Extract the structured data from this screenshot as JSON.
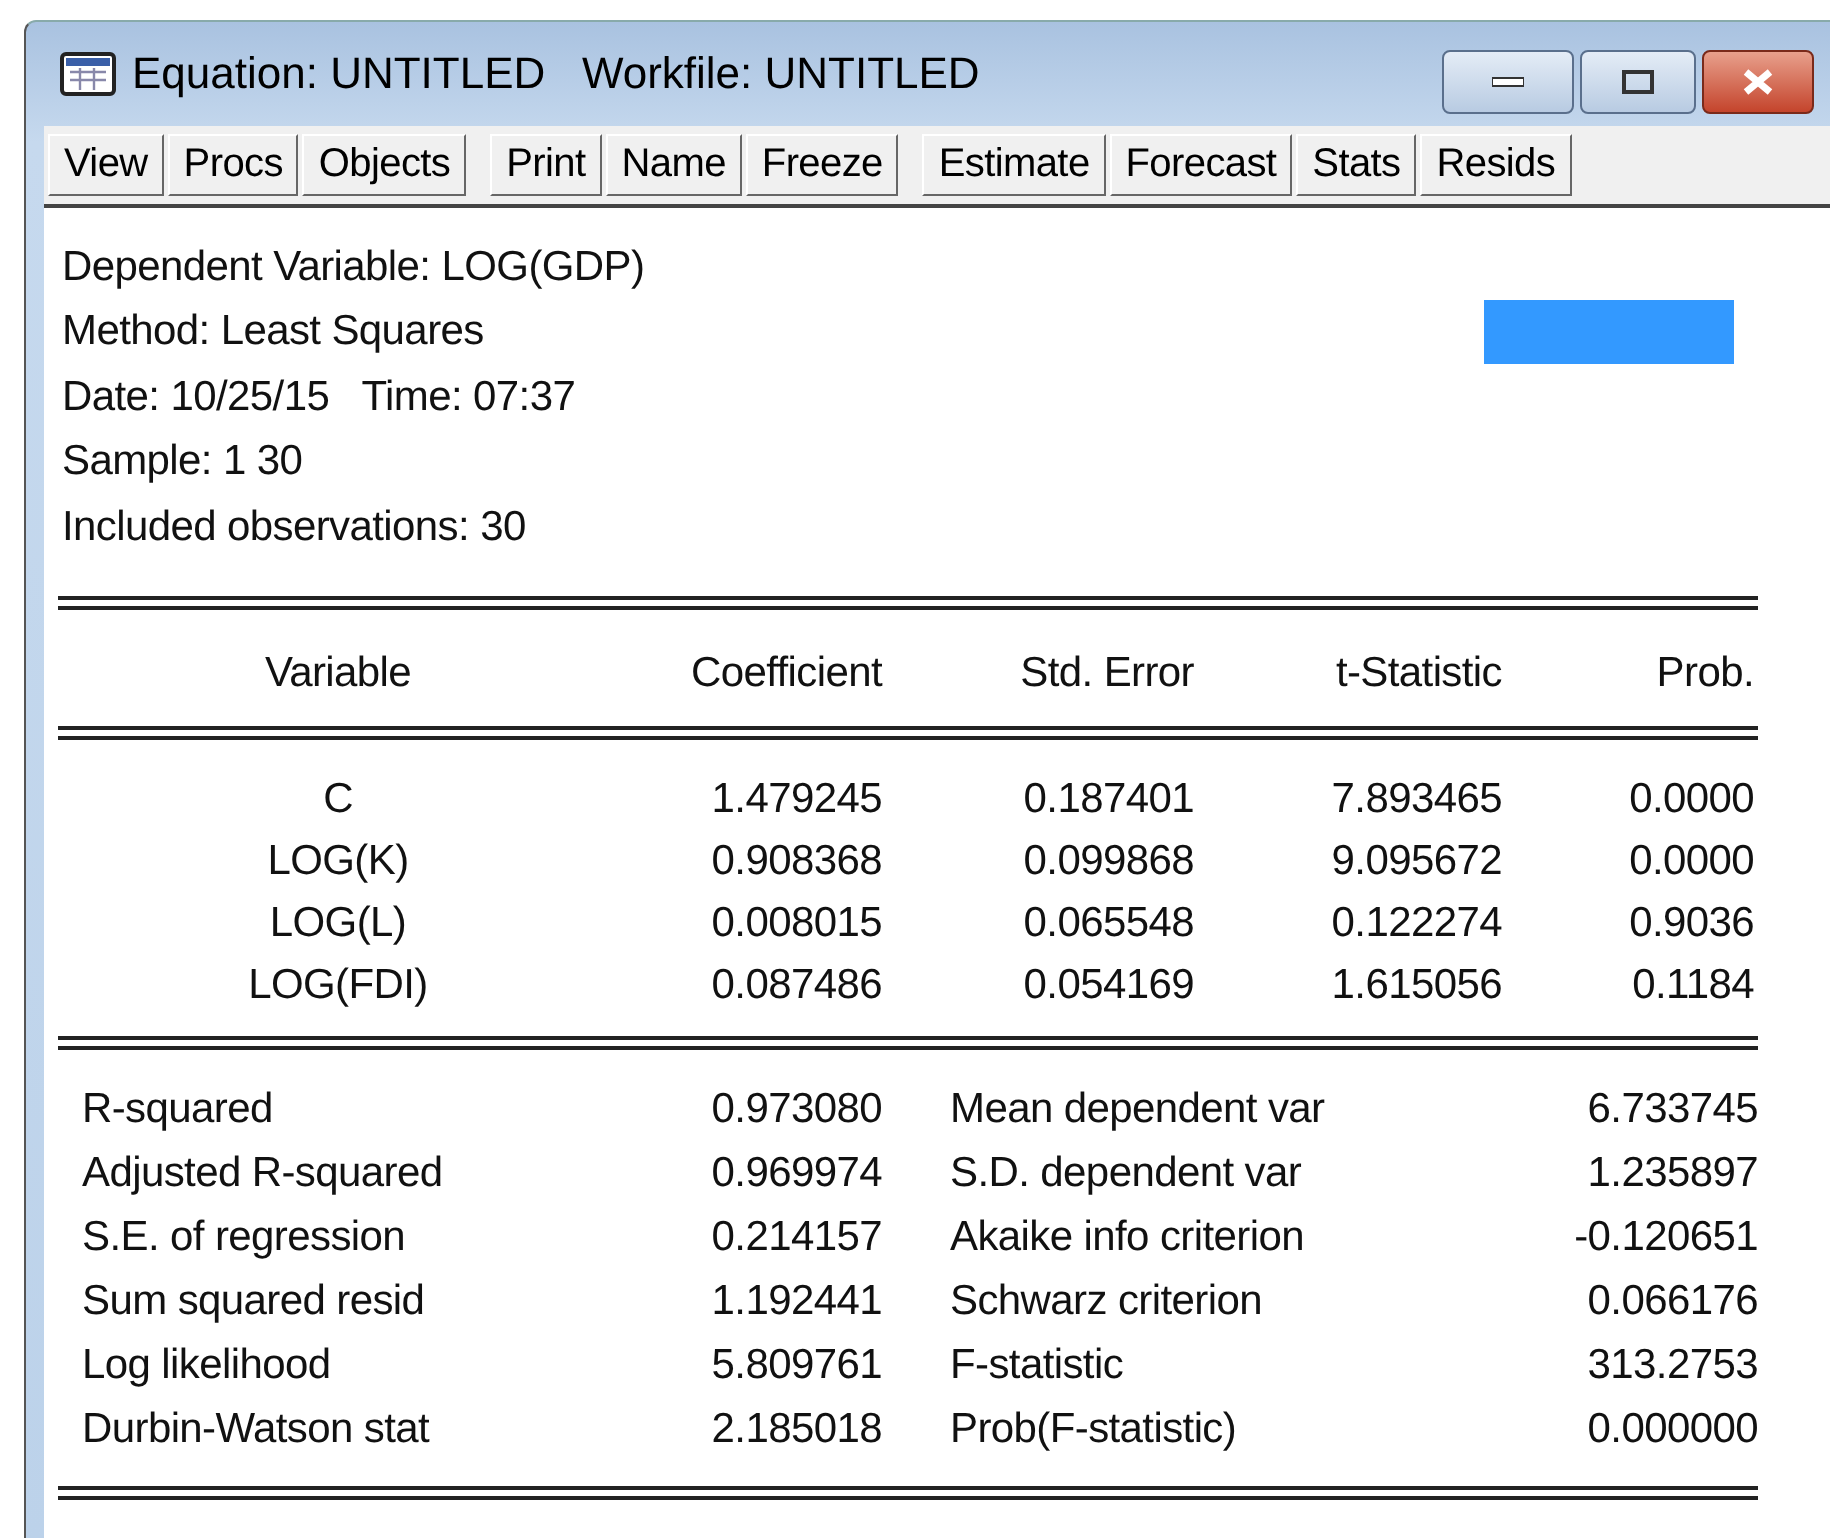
{
  "window": {
    "title": "Equation: UNTITLED   Workfile: UNTITLED"
  },
  "toolbar": [
    [
      "View",
      "Procs",
      "Objects"
    ],
    [
      "Print",
      "Name",
      "Freeze"
    ],
    [
      "Estimate",
      "Forecast",
      "Stats",
      "Resids"
    ]
  ],
  "header": [
    "Dependent Variable: LOG(GDP)",
    "Method: Least Squares",
    "Date: 10/25/15   Time: 07:37",
    "Sample: 1 30",
    "Included observations: 30"
  ],
  "table": {
    "columns": [
      "Variable",
      "Coefficient",
      "Std. Error",
      "t-Statistic",
      "Prob."
    ],
    "rows": [
      [
        "C",
        "1.479245",
        "0.187401",
        "7.893465",
        "0.0000"
      ],
      [
        "LOG(K)",
        "0.908368",
        "0.099868",
        "9.095672",
        "0.0000"
      ],
      [
        "LOG(L)",
        "0.008015",
        "0.065548",
        "0.122274",
        "0.9036"
      ],
      [
        "LOG(FDI)",
        "0.087486",
        "0.054169",
        "1.615056",
        "0.1184"
      ]
    ]
  },
  "statistics": [
    [
      "R-squared",
      "0.973080",
      "Mean dependent var",
      "6.733745"
    ],
    [
      "Adjusted R-squared",
      "0.969974",
      "S.D. dependent var",
      "1.235897"
    ],
    [
      "S.E. of regression",
      "0.214157",
      "Akaike info criterion",
      "-0.120651"
    ],
    [
      "Sum squared resid",
      "1.192441",
      "Schwarz criterion",
      "0.066176"
    ],
    [
      "Log likelihood",
      "5.809761",
      "F-statistic",
      "313.2753"
    ],
    [
      "Durbin-Watson stat",
      "2.185018",
      "Prob(F-statistic)",
      "0.000000"
    ]
  ]
}
